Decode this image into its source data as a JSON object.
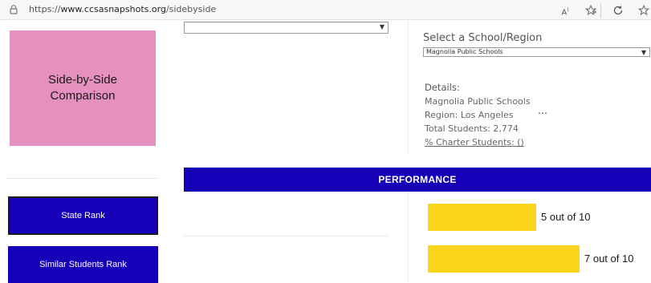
{
  "browser": {
    "url_prefix": "https://",
    "url_host": "www.ccsasnapshots.org",
    "url_path": "/sidebyside"
  },
  "sidebar": {
    "title_line1": "Side-by-Side",
    "title_line2": "Comparison",
    "buttons": [
      {
        "label": "State Rank"
      },
      {
        "label": "Similar Students Rank"
      }
    ]
  },
  "middle": {
    "dropdown_value": ""
  },
  "selector": {
    "title": "Select a School/Region",
    "selected_value": "Magnolia Public Schools"
  },
  "details": {
    "heading": "Details:",
    "name": "Magnolia Public Schools",
    "region": "Region: Los Angeles",
    "total_students": "Total Students:  2,774",
    "charter_students": "% Charter Students: ()",
    "more_glyph": "⋯"
  },
  "performance": {
    "title": "PERFORMANCE",
    "ranks": [
      {
        "label": "5 out of 10",
        "value": 5,
        "max": 10
      },
      {
        "label": "7 out of 10",
        "value": 7,
        "max": 10
      }
    ]
  },
  "colors": {
    "brand_blue": "#1500b8",
    "pink": "#e590bf",
    "bar_yellow": "#fbd51c"
  }
}
